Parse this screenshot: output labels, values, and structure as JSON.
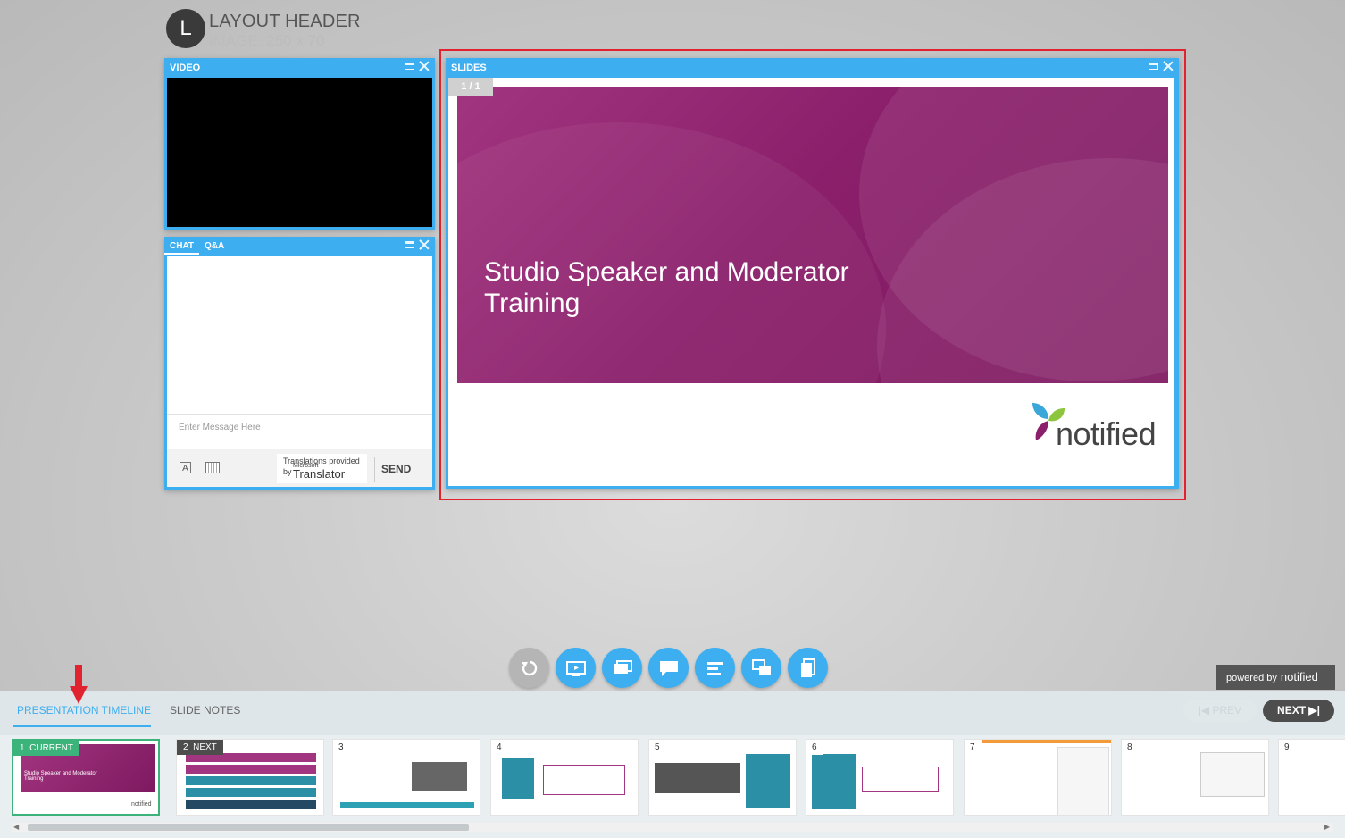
{
  "header": {
    "logo_letter": "L",
    "title": "LAYOUT HEADER",
    "subtitle": "IMAGE: 250 x 70"
  },
  "video_panel": {
    "title": "VIDEO"
  },
  "chat_panel": {
    "tabs": [
      "CHAT",
      "Q&A"
    ],
    "input_placeholder": "Enter Message Here",
    "translator": {
      "line1": "Translations provided",
      "line2_by": "by",
      "line2_ms": "Microsoft",
      "line2_name": "Translator"
    },
    "send_label": "SEND"
  },
  "slides_panel": {
    "title": "SLIDES",
    "page_indicator": "1 / 1",
    "slide_title": "Studio Speaker and Moderator Training",
    "logo_text": "notified"
  },
  "toolbar": {
    "icons": [
      "refresh-icon",
      "screen-share-icon",
      "slides-icon",
      "chat-icon",
      "agenda-icon",
      "qa-icon",
      "handouts-icon"
    ]
  },
  "powered_by": {
    "label": "powered by",
    "brand": "notified"
  },
  "bottom": {
    "tabs": [
      "PRESENTATION TIMELINE",
      "SLIDE NOTES"
    ],
    "active_tab": "PRESENTATION TIMELINE",
    "prev_label": "PREV",
    "next_label": "NEXT",
    "thumbnails": [
      {
        "number": "1",
        "tag": "CURRENT",
        "title": "Studio Speaker and Moderator Training"
      },
      {
        "number": "2",
        "tag": "NEXT"
      },
      {
        "number": "3"
      },
      {
        "number": "4"
      },
      {
        "number": "5"
      },
      {
        "number": "6"
      },
      {
        "number": "7"
      },
      {
        "number": "8"
      },
      {
        "number": "9"
      }
    ]
  },
  "colors": {
    "accent": "#3daef0",
    "highlight": "#e0232e",
    "current": "#3bb37a",
    "slide_brand": "#8b1f6b"
  }
}
